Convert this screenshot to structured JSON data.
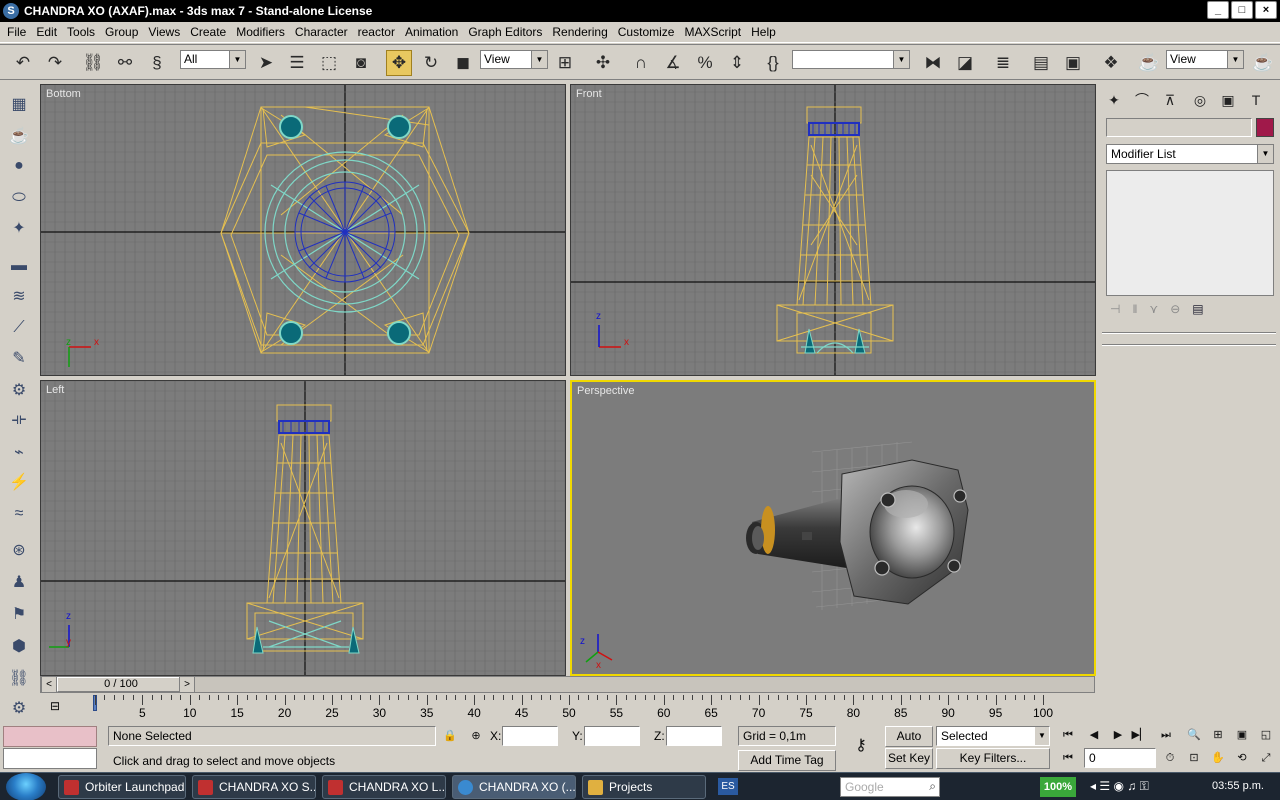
{
  "window": {
    "title": "CHANDRA XO (AXAF).max - 3ds max 7  - Stand-alone License",
    "controls": [
      "_",
      "□",
      "×"
    ]
  },
  "menu": [
    "File",
    "Edit",
    "Tools",
    "Group",
    "Views",
    "Create",
    "Modifiers",
    "Character",
    "reactor",
    "Animation",
    "Graph Editors",
    "Rendering",
    "Customize",
    "MAXScript",
    "Help"
  ],
  "toolbar": {
    "selection_filter": "All",
    "ref_coord_system": "View",
    "named_selection": "",
    "view_right": "View"
  },
  "viewports": {
    "top_left": "Bottom",
    "top_right": "Front",
    "bottom_left": "Left",
    "bottom_right": "Perspective"
  },
  "axis": {
    "x": "x",
    "y": "y",
    "z": "z"
  },
  "command_panel": {
    "modifier_list": "Modifier List",
    "object_color": "#a0194a"
  },
  "time_slider": {
    "label": "0 / 100",
    "ticks": [
      "5",
      "10",
      "15",
      "20",
      "25",
      "30",
      "35",
      "40",
      "45",
      "50",
      "55",
      "60",
      "65",
      "70",
      "75",
      "80",
      "85",
      "90",
      "95",
      "100"
    ]
  },
  "status": {
    "selection": "None Selected",
    "prompt": "Click and drag to select and move objects",
    "x_label": "X:",
    "y_label": "Y:",
    "z_label": "Z:",
    "grid": "Grid = 0,1m",
    "add_time_tag": "Add Time Tag",
    "auto_key": "Auto Key",
    "set_key": "Set Key",
    "key_mode": "Selected",
    "key_filters": "Key Filters...",
    "frame": "0"
  },
  "taskbar": {
    "items": [
      {
        "label": "Orbiter Launchpad",
        "color": "#c03030"
      },
      {
        "label": "CHANDRA XO S...",
        "color": "#c03030"
      },
      {
        "label": "CHANDRA XO L...",
        "color": "#c03030"
      },
      {
        "label": "CHANDRA XO (...",
        "color": "#3a8ad0"
      },
      {
        "label": "Projects",
        "color": "#e0b040"
      }
    ],
    "lang": "ES",
    "search": "Google",
    "zoom": "100%",
    "time": "03:55 p.m."
  }
}
